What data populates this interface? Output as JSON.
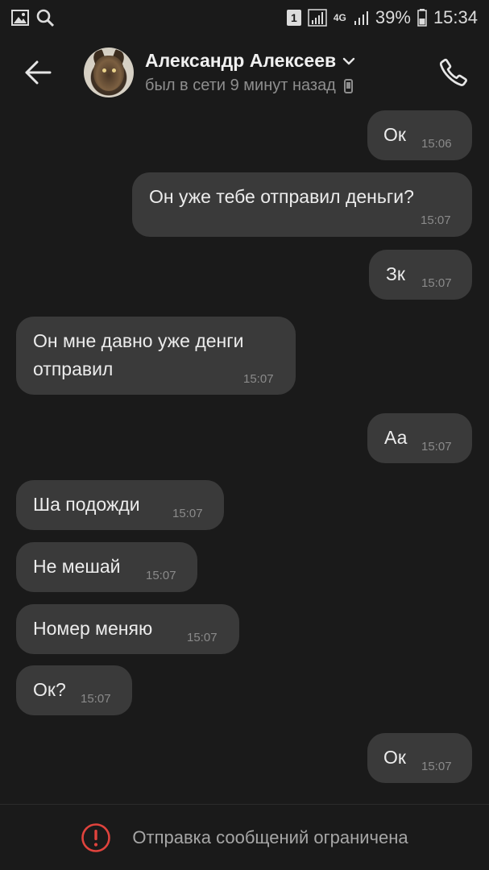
{
  "status_bar": {
    "sim_slot": "1",
    "network": "4G",
    "battery": "39%",
    "time": "15:34"
  },
  "header": {
    "contact_name": "Александр Алексеев",
    "last_seen": "был в сети 9 минут назад"
  },
  "messages": [
    {
      "direction": "outgoing",
      "text": "Ок",
      "time": "15:06"
    },
    {
      "direction": "outgoing",
      "text": "Он уже тебе отправил деньги?",
      "time": "15:07"
    },
    {
      "direction": "outgoing",
      "text": "Зк",
      "time": "15:07"
    },
    {
      "direction": "incoming",
      "text": "Он мне давно уже денги отправил",
      "time": "15:07"
    },
    {
      "direction": "outgoing",
      "text": "Аа",
      "time": "15:07"
    },
    {
      "direction": "incoming",
      "text": "Ша подожди",
      "time": "15:07"
    },
    {
      "direction": "incoming",
      "text": "Не мешай",
      "time": "15:07"
    },
    {
      "direction": "incoming",
      "text": "Номер меняю",
      "time": "15:07"
    },
    {
      "direction": "incoming",
      "text": "Ок?",
      "time": "15:07"
    },
    {
      "direction": "outgoing",
      "text": "Ок",
      "time": "15:07"
    }
  ],
  "footer": {
    "notice": "Отправка сообщений ограничена"
  },
  "colors": {
    "background": "#1a1a1a",
    "bubble": "#3a3a3a",
    "warning": "#e0433d"
  }
}
